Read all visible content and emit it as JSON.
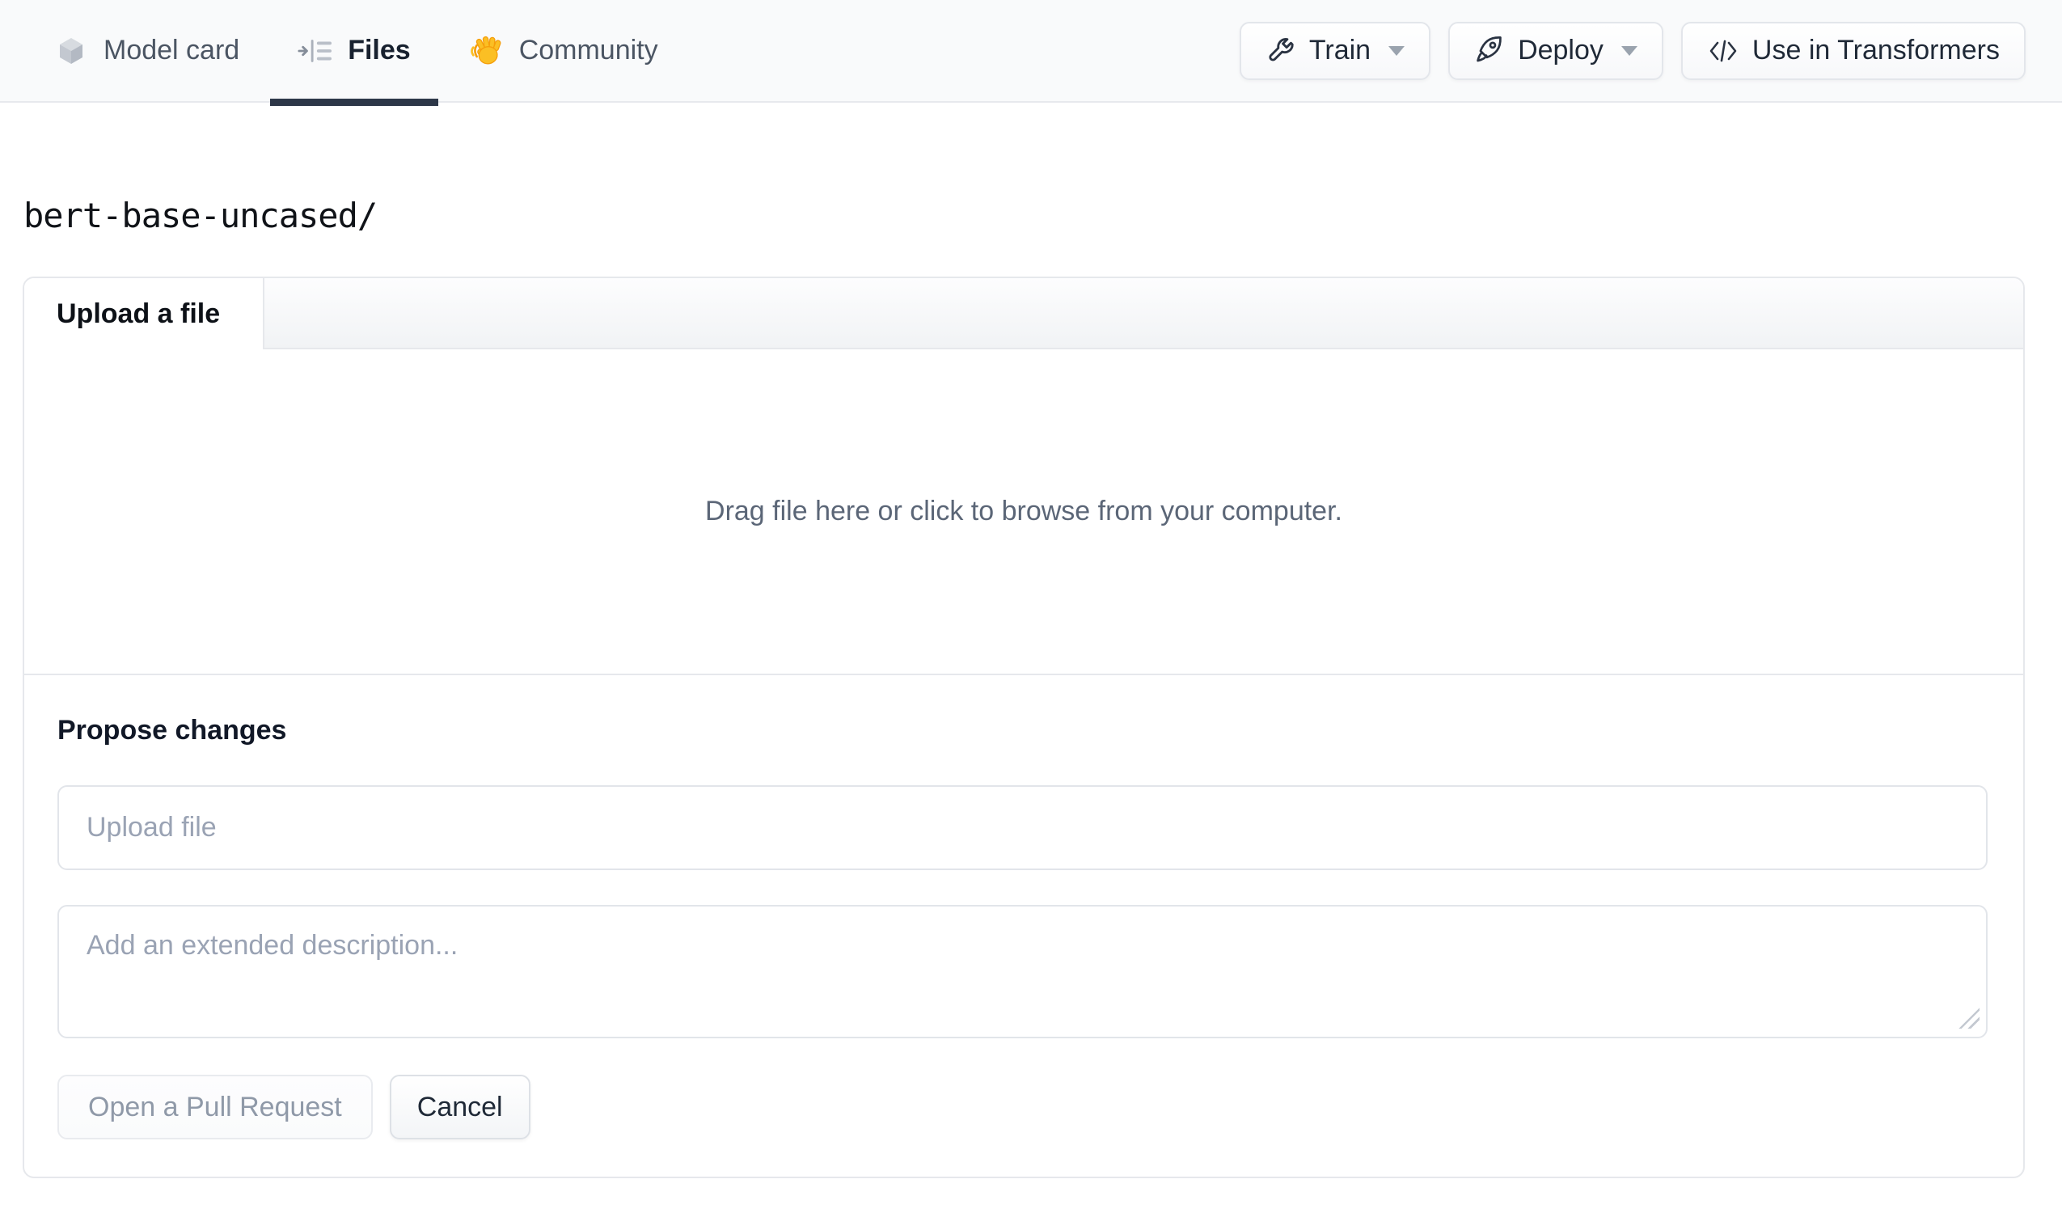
{
  "header": {
    "tabs": [
      {
        "label": "Model card",
        "icon": "cube-icon",
        "active": false
      },
      {
        "label": "Files",
        "icon": "files-list-icon",
        "active": true
      },
      {
        "label": "Community",
        "icon": "waving-hand-icon",
        "active": false
      }
    ],
    "actions": [
      {
        "label": "Train",
        "icon": "wrench-icon",
        "has_dropdown": true
      },
      {
        "label": "Deploy",
        "icon": "rocket-icon",
        "has_dropdown": true
      },
      {
        "label": "Use in Transformers",
        "icon": "code-icon",
        "has_dropdown": false
      }
    ]
  },
  "breadcrumb": {
    "path": "bert-base-uncased/"
  },
  "upload_panel": {
    "tab_label": "Upload a file",
    "dropzone_text": "Drag file here or click to browse from your computer.",
    "propose": {
      "heading": "Propose changes",
      "filename_placeholder": "Upload file",
      "description_placeholder": "Add an extended description...",
      "description_value": "",
      "open_pr_label": "Open a Pull Request",
      "cancel_label": "Cancel"
    }
  },
  "colors": {
    "topbar_bg": "#f9fafb",
    "active_tab_underline": "#2d3748",
    "panel_border": "#e6e8ec",
    "placeholder_text": "#9aa3b4",
    "primary_text": "#1f2937",
    "secondary_text": "#4b5563",
    "dropzone_text": "#5b6677",
    "disabled_button_text": "#8f99a8",
    "hand_emoji_yellow": "#fbbf24"
  }
}
